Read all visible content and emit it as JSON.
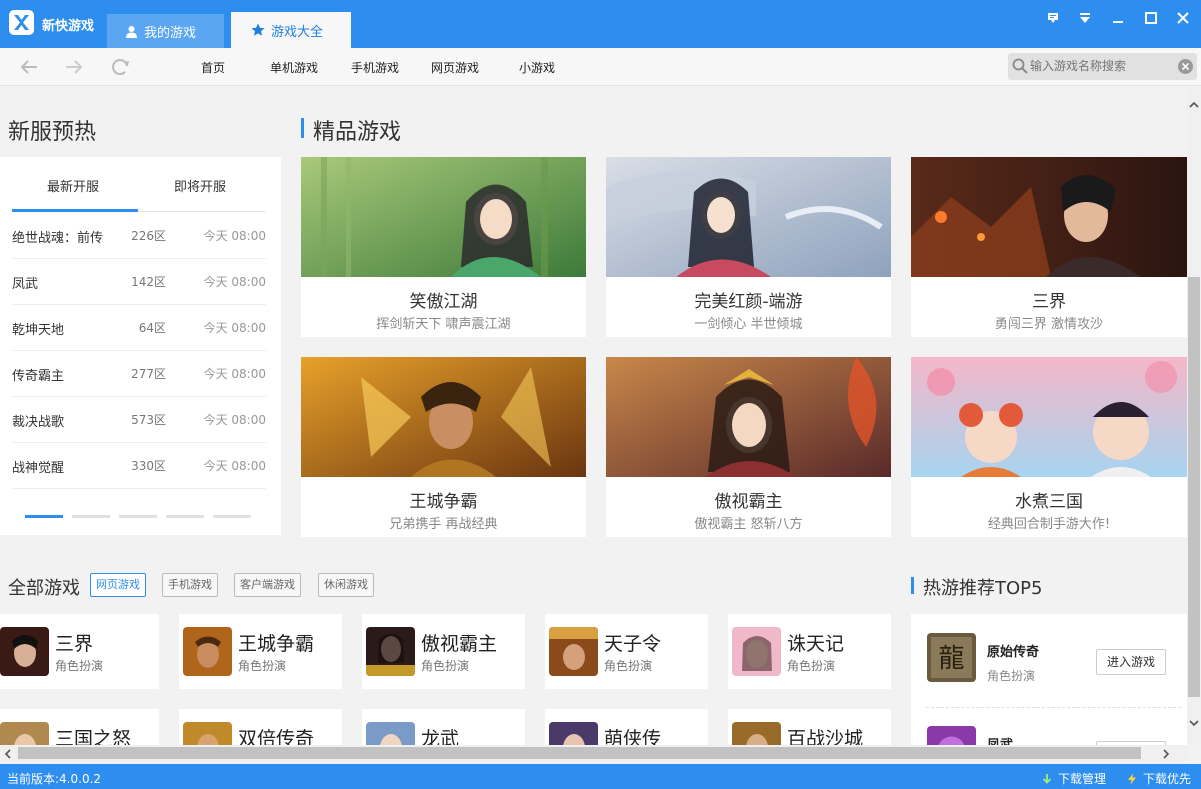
{
  "app": {
    "title": "新快游戏",
    "brand_color": "#2d8ef0"
  },
  "tabs": [
    {
      "label": "我的游戏",
      "icon": "user-icon",
      "active": false
    },
    {
      "label": "游戏大全",
      "icon": "star-icon",
      "active": true
    }
  ],
  "window_controls": [
    "feedback-icon",
    "menu-dropdown-icon",
    "minimize-icon",
    "maximize-icon",
    "close-icon"
  ],
  "nav": {
    "links": [
      "首页",
      "单机游戏",
      "手机游戏",
      "网页游戏",
      "小游戏"
    ],
    "search_placeholder": "输入游戏名称搜索"
  },
  "new_servers": {
    "title": "新服预热",
    "tabs": [
      "最新开服",
      "即将开服"
    ],
    "active_tab": 0,
    "rows": [
      {
        "name": "绝世战魂：前传",
        "zone": "226区",
        "time": "今天 08:00"
      },
      {
        "name": "凤武",
        "zone": "142区",
        "time": "今天 08:00"
      },
      {
        "name": "乾坤天地",
        "zone": "64区",
        "time": "今天 08:00"
      },
      {
        "name": "传奇霸主",
        "zone": "277区",
        "time": "今天 08:00"
      },
      {
        "name": "裁决战歌",
        "zone": "573区",
        "time": "今天 08:00"
      },
      {
        "name": "战神觉醒",
        "zone": "330区",
        "time": "今天 08:00"
      }
    ],
    "page_count": 5,
    "current_page": 1
  },
  "featured": {
    "title": "精品游戏",
    "cards": [
      {
        "name": "笑傲江湖",
        "tagline": "挥剑斩天下 啸声震江湖"
      },
      {
        "name": "完美红颜-端游",
        "tagline": "一剑倾心 半世倾城"
      },
      {
        "name": "三界",
        "tagline": "勇闯三界 激情攻沙"
      },
      {
        "name": "王城争霸",
        "tagline": "兄弟携手 再战经典"
      },
      {
        "name": "傲视霸主",
        "tagline": "傲视霸主 怒斩八方"
      },
      {
        "name": "水煮三国",
        "tagline": "经典回合制手游大作!"
      }
    ]
  },
  "all_games": {
    "title": "全部游戏",
    "filters": [
      "网页游戏",
      "手机游戏",
      "客户端游戏",
      "休闲游戏"
    ],
    "active_filter": 0,
    "games": [
      {
        "name": "三界",
        "category": "角色扮演"
      },
      {
        "name": "王城争霸",
        "category": "角色扮演"
      },
      {
        "name": "傲视霸主",
        "category": "角色扮演"
      },
      {
        "name": "天子令",
        "category": "角色扮演"
      },
      {
        "name": "诛天记",
        "category": "角色扮演"
      },
      {
        "name": "三国之怒",
        "category": ""
      },
      {
        "name": "双倍传奇",
        "category": ""
      },
      {
        "name": "龙武",
        "category": ""
      },
      {
        "name": "萌侠传",
        "category": ""
      },
      {
        "name": "百战沙城",
        "category": ""
      }
    ]
  },
  "hot_top5": {
    "title": "热游推荐TOP5",
    "items": [
      {
        "name": "原始传奇",
        "category": "角色扮演",
        "button": "进入游戏"
      },
      {
        "name": "凤武",
        "category": "",
        "button": ""
      }
    ]
  },
  "status": {
    "version": "当前版本:4.0.0.2",
    "download_manager": "下载管理",
    "download_priority": "下载优先"
  }
}
